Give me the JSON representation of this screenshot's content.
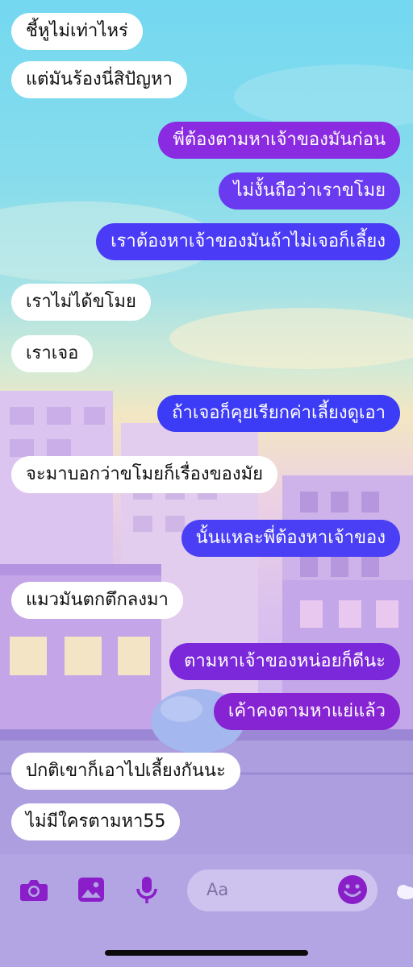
{
  "messages": [
    {
      "side": "in",
      "text": "ชี้หูไม่เท่าไหร่"
    },
    {
      "side": "in",
      "text": "แต่มันร้องนี่สิปัญหา"
    },
    {
      "side": "out",
      "text": "พี่ต้องตามหาเจ้าของมันก่อน"
    },
    {
      "side": "out",
      "text": "ไม่งั้นถือว่าเราขโมย"
    },
    {
      "side": "out",
      "text": "เราต้องหาเจ้าของมันถ้าไม่เจอก็เลี้ยง"
    },
    {
      "side": "in",
      "text": "เราไม่ได้ขโมย"
    },
    {
      "side": "in",
      "text": "เราเจอ"
    },
    {
      "side": "out",
      "text": "ถ้าเจอก็คุยเรียกค่าเลี้ยงดูเอา"
    },
    {
      "side": "in",
      "text": "จะมาบอกว่าขโมยก็เรื่องของมัย"
    },
    {
      "side": "out",
      "text": "นั้นแหละพี่ต้องหาเจ้าของ"
    },
    {
      "side": "in",
      "text": "แมวมันตกตึกลงมา"
    },
    {
      "side": "out",
      "text": "ตามหาเจ้าของหน่อยก็ดีนะ"
    },
    {
      "side": "out",
      "text": "เค้าคงตามหาแย่แล้ว"
    },
    {
      "side": "in",
      "text": "ปกติเขาก็เอาไปเลี้ยงกันนะ"
    },
    {
      "side": "in",
      "text": "ไม่มีใครตามหา55"
    }
  ],
  "composer": {
    "placeholder": "Aa",
    "icons": [
      "camera-icon",
      "image-icon",
      "microphone-icon",
      "emoji-icon"
    ],
    "accent_color": "#8a1fc9"
  },
  "theme": {
    "outgoing_colors_top_to_bottom": [
      "#8a2be2",
      "#6a3af0",
      "#4a3cf6",
      "#3c3bf5",
      "#4a3ff4",
      "#7b28db",
      "#8623d2"
    ]
  }
}
